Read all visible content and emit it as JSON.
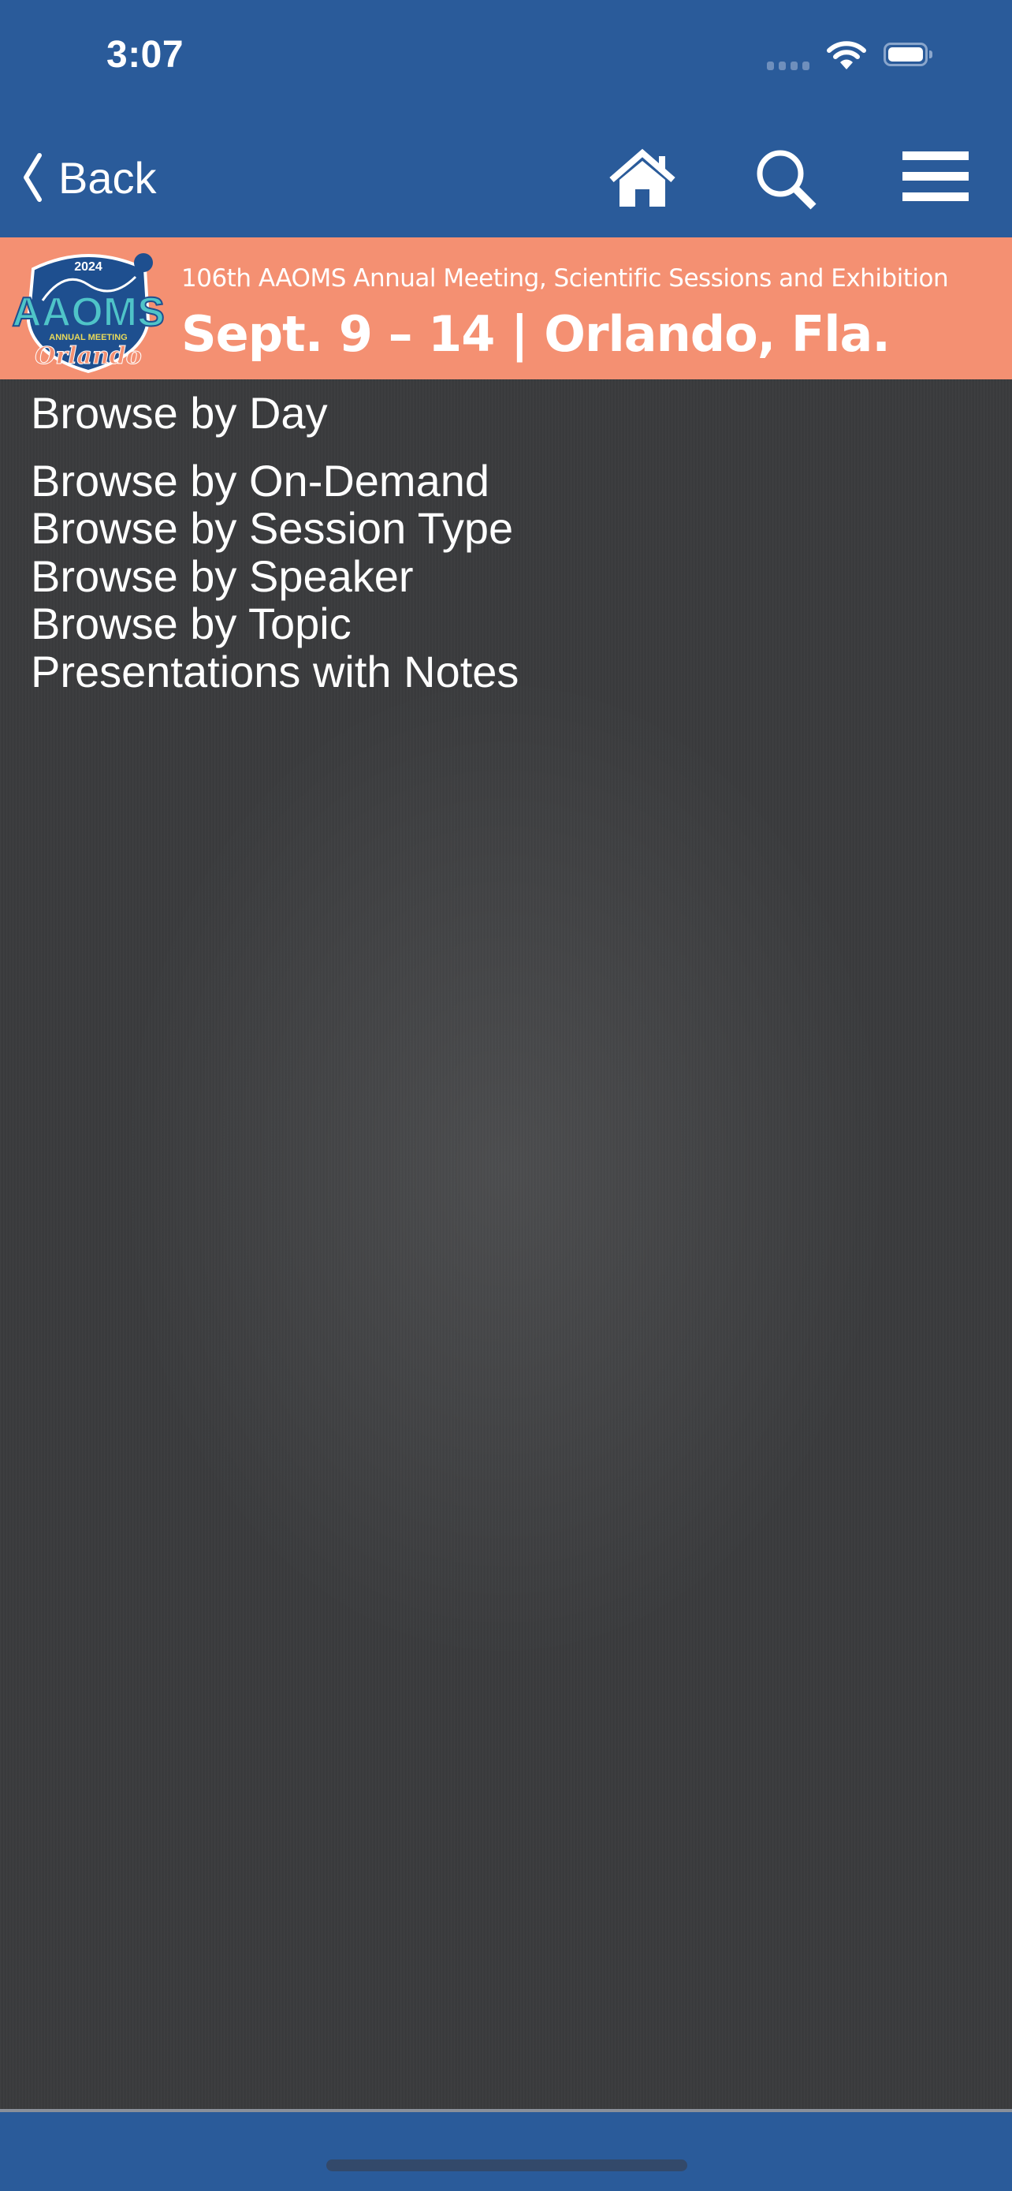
{
  "status_bar": {
    "time": "3:07",
    "icons": [
      "cellular-signal-icon",
      "wifi-icon",
      "battery-icon"
    ]
  },
  "nav_bar": {
    "back_label": "Back",
    "icons": [
      "back-chevron-icon",
      "home-icon",
      "search-icon",
      "hamburger-menu-icon"
    ]
  },
  "banner": {
    "logo": {
      "year": "2024",
      "name": "AAOMS",
      "tagline": "ANNUAL MEETING",
      "city": "Orlando"
    },
    "subtitle": "106th AAOMS Annual Meeting, Scientific Sessions and Exhibition",
    "title": "Sept. 9 – 14 | Orlando, Fla."
  },
  "menu": {
    "items": [
      {
        "label": "Browse by Day"
      },
      {
        "label": "Browse by On-Demand"
      },
      {
        "label": "Browse by Session Type"
      },
      {
        "label": "Browse by Speaker"
      },
      {
        "label": "Browse by Topic"
      },
      {
        "label": "Presentations with Notes"
      }
    ]
  },
  "colors": {
    "bar_blue": "#2a5b9a",
    "banner_salmon": "#f49072",
    "background_dark": "#3a3b3d",
    "logo_teal": "#4fc4c8",
    "logo_navy": "#1e4f8f"
  }
}
